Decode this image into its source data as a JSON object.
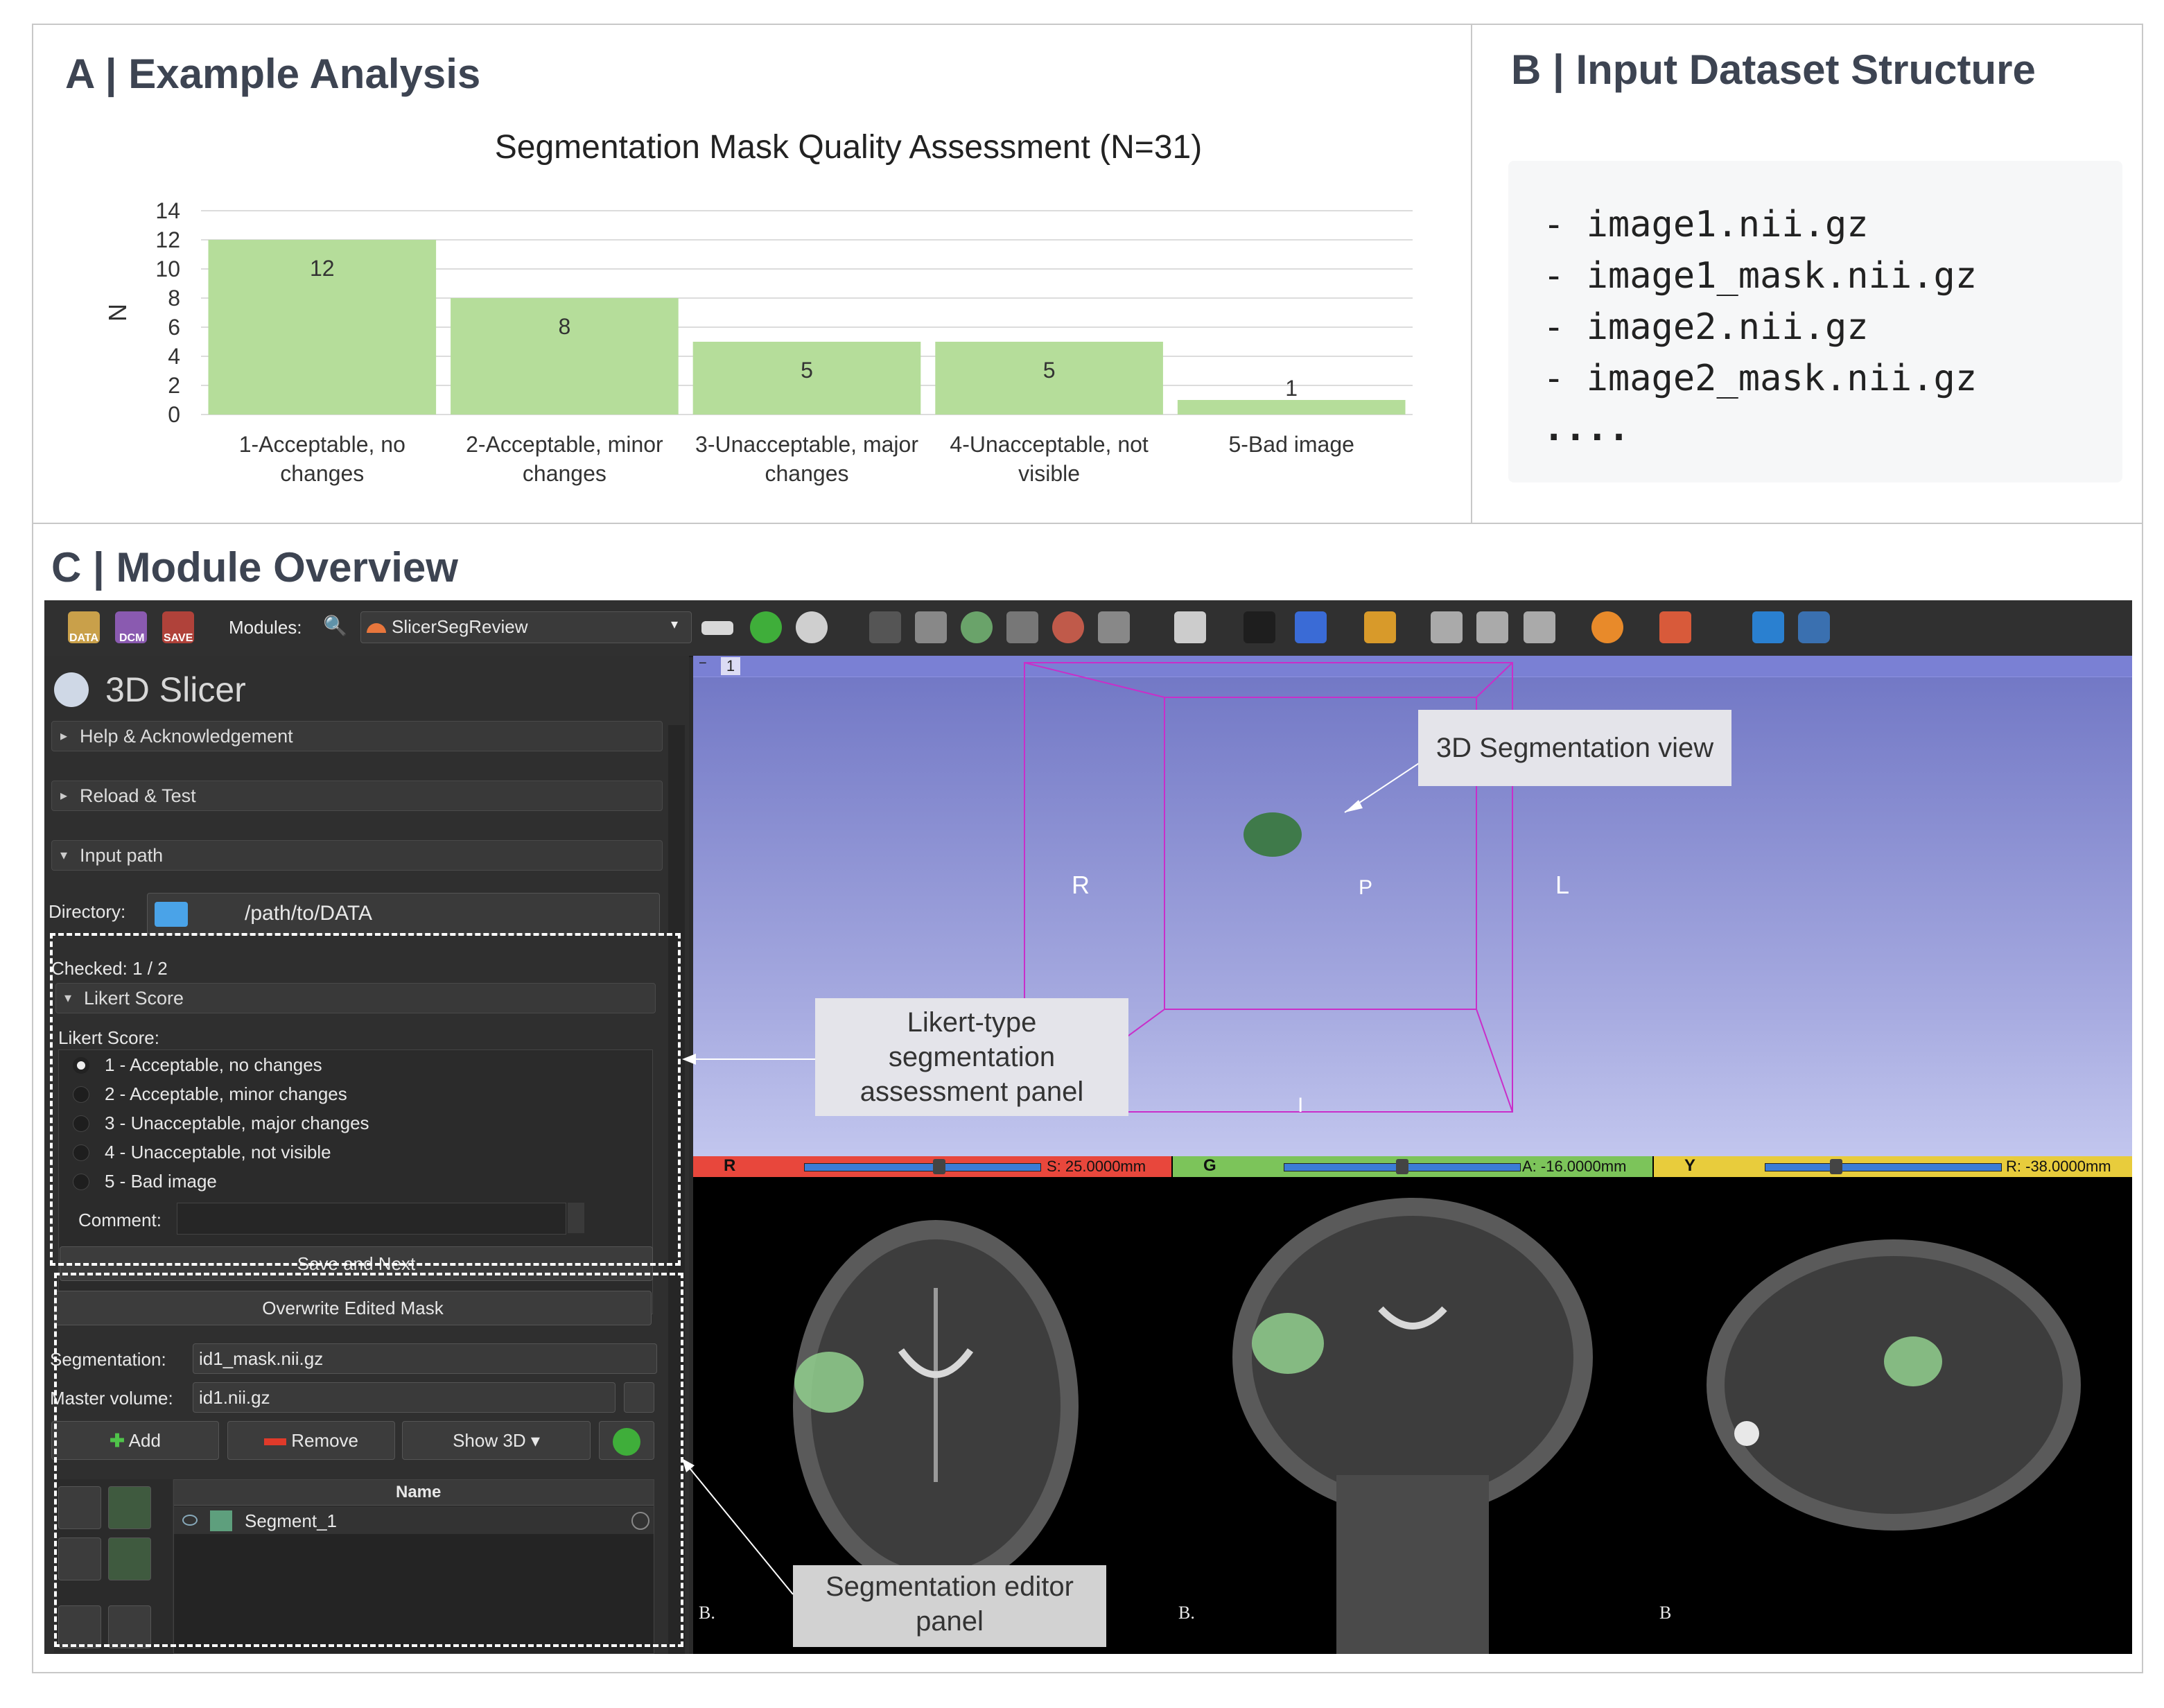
{
  "panel_a": {
    "title": "A | Example Analysis"
  },
  "panel_b": {
    "title": "B | Input Dataset Structure",
    "files": [
      "- image1.nii.gz",
      "- image1_mask.nii.gz",
      "- image2.nii.gz",
      "- image2_mask.nii.gz",
      "...."
    ]
  },
  "panel_c": {
    "title": "C | Module Overview"
  },
  "chart_data": {
    "type": "bar",
    "title": "Segmentation Mask Quality Assessment (N=31)",
    "xlabel": "",
    "ylabel": "N",
    "categories": [
      "1-Acceptable, no changes",
      "2-Acceptable, minor changes",
      "3-Unacceptable, major changes",
      "4-Unacceptable, not visible",
      "5-Bad image"
    ],
    "category_lines": [
      [
        "1-Acceptable, no",
        "changes"
      ],
      [
        "2-Acceptable, minor",
        "changes"
      ],
      [
        "3-Unacceptable, major",
        "changes"
      ],
      [
        "4-Unacceptable, not",
        "visible"
      ],
      [
        "5-Bad image"
      ]
    ],
    "values": [
      12,
      8,
      5,
      5,
      1
    ],
    "ylim": [
      0,
      14
    ],
    "yticks": [
      0,
      2,
      4,
      6,
      8,
      10,
      12,
      14
    ],
    "grid": true,
    "bar_color": "#b5dd9a"
  },
  "slicer": {
    "toolbar": {
      "data_label": "DATA",
      "dcm_label": "DCM",
      "save_label": "SAVE",
      "modules_label": "Modules:",
      "module_selected": "SlicerSegReview"
    },
    "app_name": "3D Slicer",
    "sections": {
      "help": "Help & Acknowledgement",
      "reload": "Reload & Test",
      "input_path": "Input path"
    },
    "directory_label": "Directory:",
    "directory_value": "/path/to/DATA",
    "checked": "Checked: 1 / 2",
    "likert_section": "Likert Score",
    "likert_label": "Likert Score:",
    "likert_options": [
      "1 - Acceptable, no changes",
      "2 - Acceptable, minor changes",
      "3 - Unacceptable, major changes",
      "4 - Unacceptable, not visible",
      "5 - Bad image"
    ],
    "likert_selected": 0,
    "comment_label": "Comment:",
    "save_next": "Save and Next",
    "overwrite": "Overwrite Edited Mask",
    "segmentation_label": "Segmentation:",
    "segmentation_value": "id1_mask.nii.gz",
    "master_label": "Master volume:",
    "master_value": "id1.nii.gz",
    "add": "Add",
    "remove": "Remove",
    "show3d": "Show 3D",
    "table_header_name": "Name",
    "segment_name": "Segment_1",
    "segment_color": "#5e9f7d",
    "view3d": {
      "tab": "1",
      "labels": {
        "r": "R",
        "p": "P",
        "l": "L",
        "i": "I"
      }
    },
    "slices": [
      {
        "letter": "R",
        "offset": "S: 25.0000mm",
        "color": "#e8473c",
        "corner": "B."
      },
      {
        "letter": "G",
        "offset": "A: -16.0000mm",
        "color": "#7cc45a",
        "corner": "B."
      },
      {
        "letter": "Y",
        "offset": "R: -38.0000mm",
        "color": "#e8cc3c",
        "corner": "B"
      }
    ]
  },
  "callouts": {
    "view3d": "3D Segmentation view",
    "likert": [
      "Likert-type",
      "segmentation",
      "assessment panel"
    ],
    "editor": [
      "Segmentation editor",
      "panel"
    ]
  }
}
